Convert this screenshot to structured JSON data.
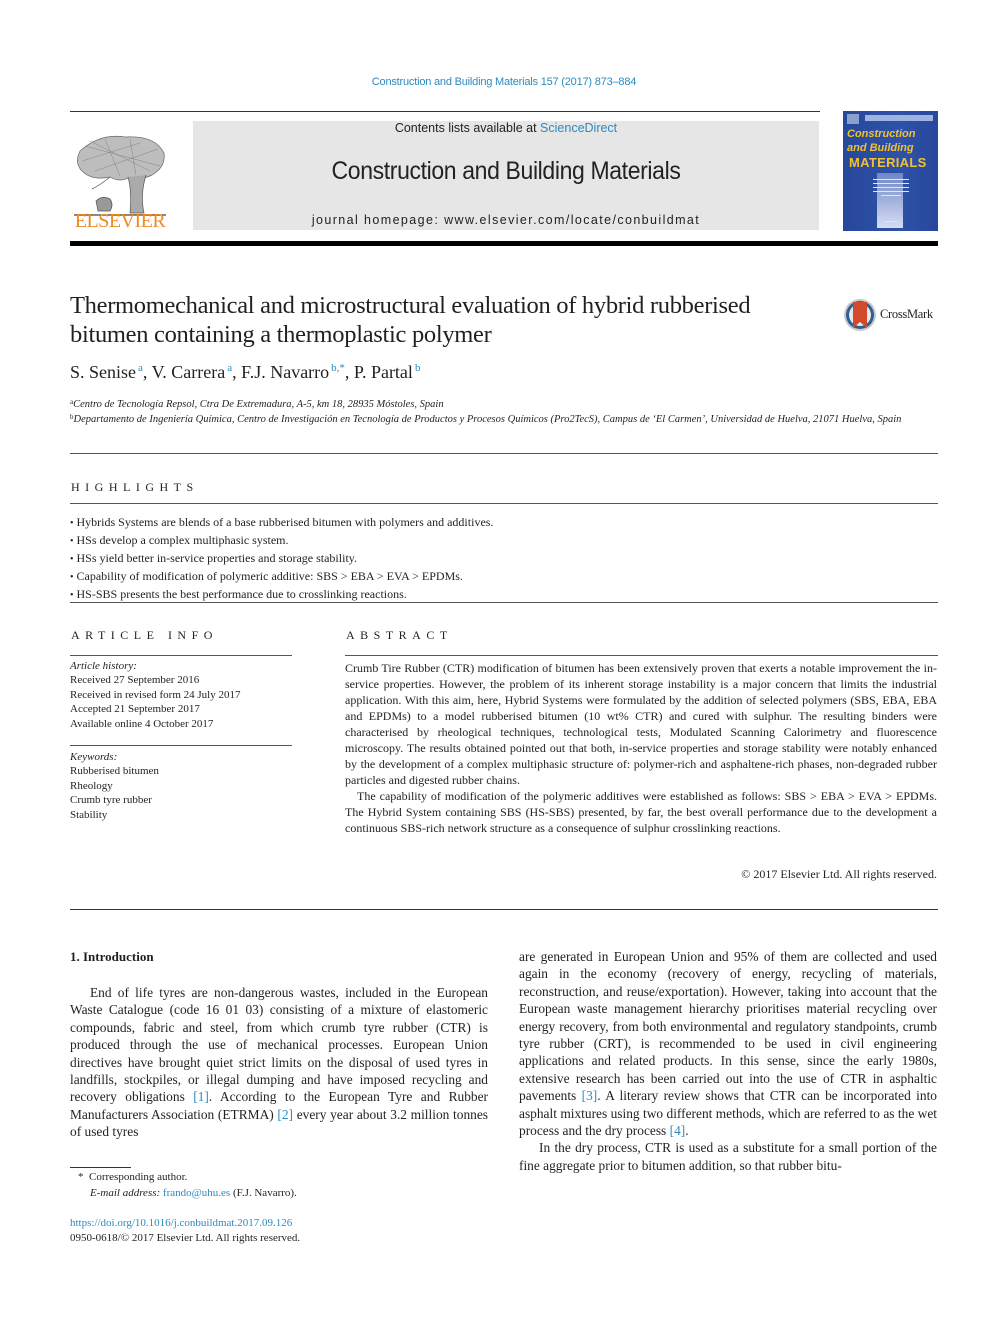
{
  "header": {
    "journal_reference": "Construction and Building Materials 157 (2017) 873–884",
    "publisher_logo_text": "ELSEVIER",
    "contents_prefix": "Contents lists available at ",
    "contents_link": "ScienceDirect",
    "journal_title": "Construction and Building Materials",
    "homepage_label": "journal homepage: ",
    "homepage_url": "www.elsevier.com/locate/conbuildmat",
    "cover": {
      "title_line1": "Construction",
      "title_line2": "and Building",
      "title_line3": "MATERIALS"
    },
    "colors": {
      "link": "#2e8bc0",
      "elsevier_orange": "#f08a24",
      "masthead_grey": "#e6e6e6",
      "cover_blue": "#2e52a8",
      "cover_yellow": "#f2c12e"
    }
  },
  "article": {
    "title": "Thermomechanical and microstructural evaluation of hybrid rubberised bitumen containing a thermoplastic polymer",
    "crossmark_label": "CrossMark",
    "authors": [
      {
        "name": "S. Senise",
        "affil": "a"
      },
      {
        "name": "V. Carrera",
        "affil": "a"
      },
      {
        "name": "F.J. Navarro",
        "affil": "b,*"
      },
      {
        "name": "P. Partal",
        "affil": "b"
      }
    ],
    "affiliations": [
      {
        "key": "a",
        "text": "Centro de Tecnología Repsol, Ctra De Extremadura, A-5, km 18, 28935 Móstoles, Spain"
      },
      {
        "key": "b",
        "text": "Departamento de Ingeniería Química, Centro de Investigación en Tecnología de Productos y Procesos Químicos (Pro2TecS), Campus de ‘El Carmen’, Universidad de Huelva, 21071 Huelva, Spain"
      }
    ]
  },
  "highlights": {
    "heading": "HIGHLIGHTS",
    "items": [
      "Hybrids Systems are blends of a base rubberised bitumen with polymers and additives.",
      "HSs develop a complex multiphasic system.",
      "HSs yield better in-service properties and storage stability.",
      "Capability of modification of polymeric additive: SBS > EBA > EVA > EPDMs.",
      "HS-SBS presents the best performance due to crosslinking reactions."
    ]
  },
  "article_info": {
    "heading": "ARTICLE INFO",
    "history_label": "Article history:",
    "history": [
      "Received 27 September 2016",
      "Received in revised form 24 July 2017",
      "Accepted 21 September 2017",
      "Available online 4 October 2017"
    ],
    "keywords_label": "Keywords:",
    "keywords": [
      "Rubberised bitumen",
      "Rheology",
      "Crumb tyre rubber",
      "Stability"
    ]
  },
  "abstract": {
    "heading": "ABSTRACT",
    "paragraphs": [
      "Crumb Tire Rubber (CTR) modification of bitumen has been extensively proven that exerts a notable improvement the in-service properties. However, the problem of its inherent storage instability is a major concern that limits the industrial application. With this aim, here, Hybrid Systems were formulated by the addition of selected polymers (SBS, EBA, EBA and EPDMs) to a model rubberised bitumen (10 wt% CTR) and cured with sulphur. The resulting binders were characterised by rheological techniques, technological tests, Modulated Scanning Calorimetry and fluorescence microscopy. The results obtained pointed out that both, in-service properties and storage stability were notably enhanced by the development of a complex multiphasic structure of: polymer-rich and asphaltene-rich phases, non-degraded rubber particles and digested rubber chains.",
      "The capability of modification of the polymeric additives were established as follows: SBS > EBA > EVA > EPDMs. The Hybrid System containing SBS (HS-SBS) presented, by far, the best overall performance due to the development a continuous SBS-rich network structure as a consequence of sulphur crosslinking reactions."
    ],
    "copyright": "© 2017 Elsevier Ltd. All rights reserved."
  },
  "body": {
    "section_heading": "1. Introduction",
    "left_paragraph": {
      "p1": "End of life tyres are non-dangerous wastes, included in the European Waste Catalogue (code 16 01 03) consisting of a mixture of elastomeric compounds, fabric and steel, from which crumb tyre rubber (CTR) is produced through the use of mechanical processes. European Union directives have brought quiet strict limits on the disposal of used tyres in landfills, stockpiles, or illegal dumping and have imposed recycling and recovery obligations ",
      "ref1": "[1]",
      "p2": ". According to the European Tyre and Rubber Manufacturers Association (ETRMA) ",
      "ref2": "[2]",
      "p3": " every year about 3.2 million tonnes of used tyres"
    },
    "right_paragraph": {
      "p1": "are generated in European Union and 95% of them are collected and used again in the economy (recovery of energy, recycling of materials, reconstruction, and reuse/exportation). However, taking into account that the European waste management hierarchy prioritises material recycling over energy recovery, from both environmental and regulatory standpoints, crumb tyre rubber (CRT), is recommended to be used in civil engineering applications and related products. In this sense, since the early 1980s, extensive research has been carried out into the use of CTR in asphaltic pavements ",
      "ref3": "[3]",
      "p2": ". A literary review shows that CTR can be incorporated into asphalt mixtures using two different methods, which are referred to as the wet process and the dry process ",
      "ref4": "[4]",
      "p3": ".",
      "p4": "In the dry process, CTR is used as a substitute for a small portion of the fine aggregate prior to bitumen addition, so that rubber bitu-"
    }
  },
  "footnote": {
    "marker": "*",
    "corresponding": "Corresponding author.",
    "email_label": "E-mail address: ",
    "email": "frando@uhu.es",
    "email_owner": " (F.J. Navarro).",
    "doi": "https://doi.org/10.1016/j.conbuildmat.2017.09.126",
    "issn_copyright": "0950-0618/© 2017 Elsevier Ltd. All rights reserved."
  }
}
